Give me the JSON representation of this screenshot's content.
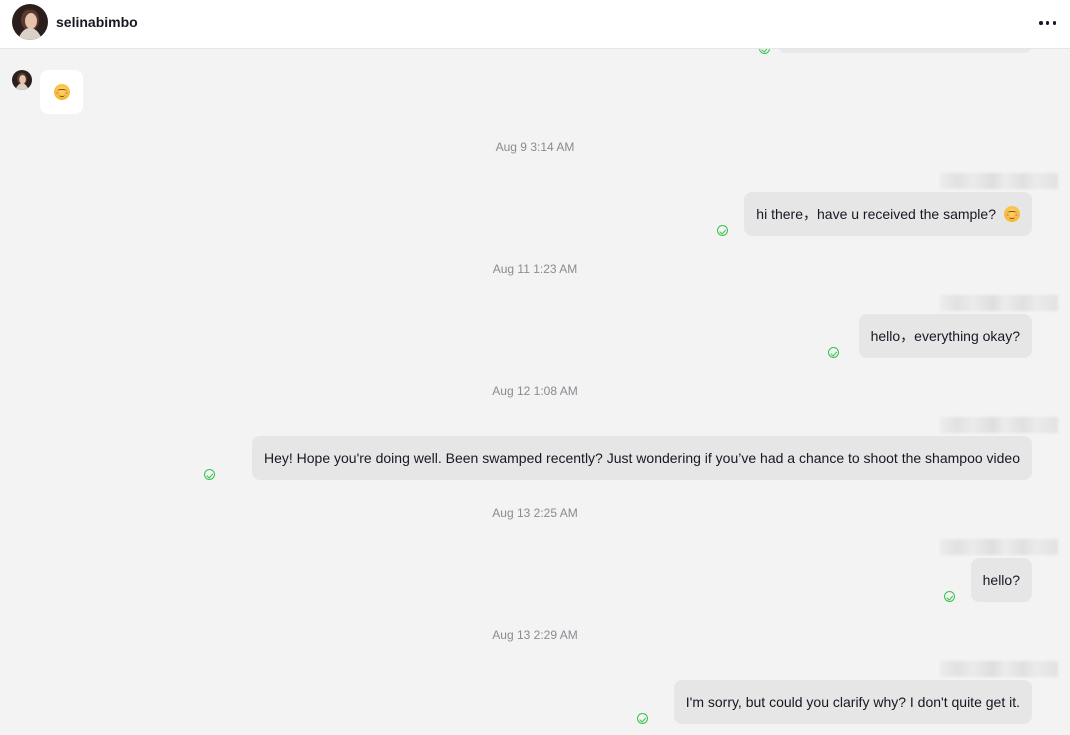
{
  "header": {
    "username": "selinabimbo",
    "more_icon": "more-horizontal-icon"
  },
  "messages": [
    {
      "type": "incoming",
      "emoji": "smiling-face-with-hearts"
    },
    {
      "timestamp": "Aug 9 3:14 AM",
      "text": "hi there，have u received the sample?",
      "trailing_emoji": "smiling-face-with-hearts",
      "status": "read"
    },
    {
      "timestamp": "Aug 11 1:23 AM",
      "text": "hello，everything okay?",
      "status": "read"
    },
    {
      "timestamp": "Aug 12 1:08 AM",
      "text": "Hey! Hope you're doing well. Been swamped recently? Just wondering if you’ve had a chance to shoot the shampoo video",
      "status": "read"
    },
    {
      "timestamp": "Aug 13 2:25 AM",
      "text": "hello?",
      "status": "read"
    },
    {
      "timestamp": "Aug 13 2:29 AM",
      "text": "I'm sorry, but could you clarify why? I don't quite get it.",
      "status": "read"
    }
  ],
  "colors": {
    "background": "#f3f3f3",
    "outgoing_bubble": "#e6e6e6",
    "read_check": "#37c24b",
    "timestamp": "#8a8b91"
  }
}
